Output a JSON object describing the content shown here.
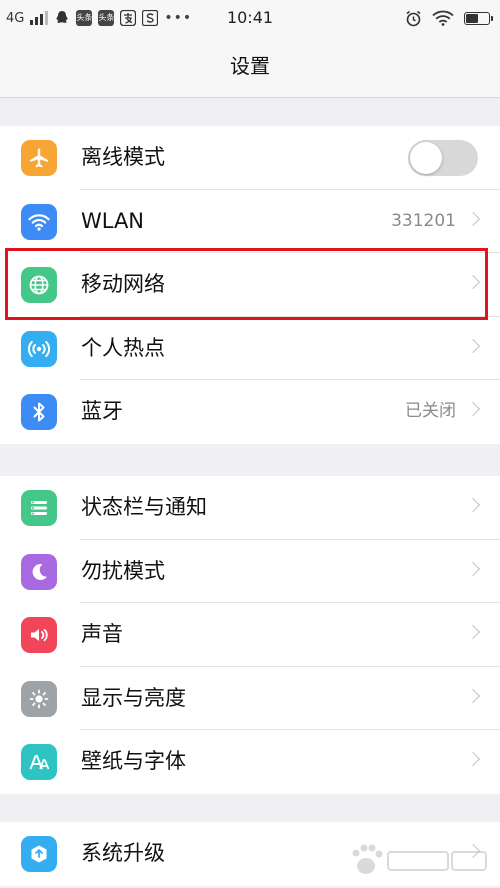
{
  "status_bar": {
    "network": "4G",
    "app_icons": [
      "头条",
      "头条"
    ],
    "more": "•••",
    "time": "10:41"
  },
  "header": {
    "title": "设置"
  },
  "colors": {
    "airplane": "#f7a534",
    "wlan": "#3d8bf5",
    "mobile_network": "#44c789",
    "hotspot": "#34aef0",
    "bluetooth": "#3d8bf5",
    "status_notify": "#44c789",
    "dnd": "#a86ae0",
    "sound": "#f2455a",
    "display": "#9ea3a8",
    "wallpaper": "#2fc4c4",
    "update": "#34aef0",
    "highlight": "#e0141e"
  },
  "sections": [
    {
      "items": [
        {
          "label": "离线模式",
          "icon": "airplane-icon",
          "control": "toggle",
          "toggle_on": false
        },
        {
          "label": "WLAN",
          "icon": "wifi-icon",
          "value": "331201"
        },
        {
          "label": "移动网络",
          "icon": "globe-icon",
          "highlighted": true
        },
        {
          "label": "个人热点",
          "icon": "hotspot-icon"
        },
        {
          "label": "蓝牙",
          "icon": "bluetooth-icon",
          "value": "已关闭"
        }
      ]
    },
    {
      "items": [
        {
          "label": "状态栏与通知",
          "icon": "notification-list-icon"
        },
        {
          "label": "勿扰模式",
          "icon": "moon-icon"
        },
        {
          "label": "声音",
          "icon": "speaker-icon"
        },
        {
          "label": "显示与亮度",
          "icon": "sun-icon"
        },
        {
          "label": "壁纸与字体",
          "icon": "font-icon"
        }
      ]
    },
    {
      "items": [
        {
          "label": "系统升级",
          "icon": "update-icon"
        }
      ]
    }
  ]
}
